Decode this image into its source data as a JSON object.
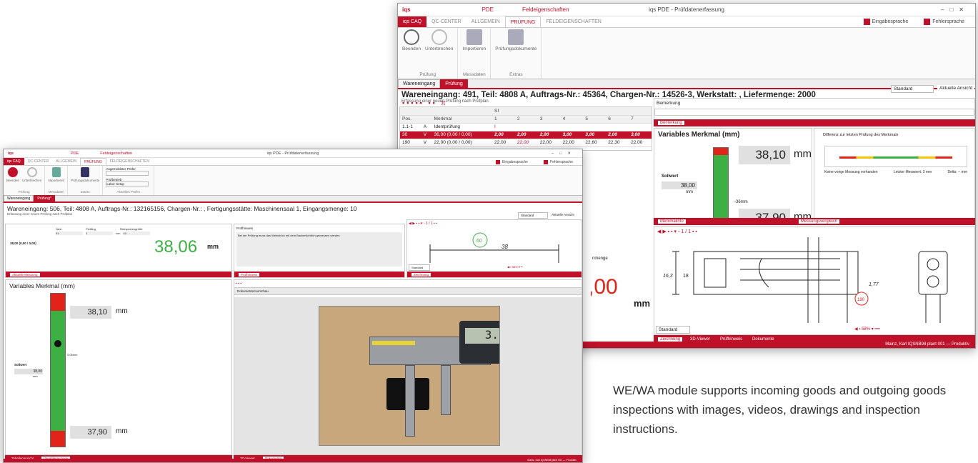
{
  "back_window": {
    "title": "iqs PDE - Prüfdatenerfassung",
    "context_tab_group": "PDE",
    "context_tab_label": "Feldeigenschaften",
    "ribbon_tabs": [
      "iqs CAQ",
      "QC-CENTER",
      "ALLGEMEIN",
      "PRÜFUNG",
      "FELDEIGENSCHAFTEN"
    ],
    "language_dialog": "Eingabesprache",
    "language_error": "Fehlersprache",
    "ribbon_groups": [
      {
        "label": "Prüfung",
        "buttons": [
          "Beenden",
          "Unterbrechen"
        ]
      },
      {
        "label": "Messdaten",
        "buttons": [
          "Importieren"
        ]
      },
      {
        "label": "Extras",
        "buttons": [
          "Prüfungsdokumente"
        ]
      }
    ],
    "doc_tabs": [
      "Wareneingang",
      "Prüfung"
    ],
    "header": "Wareneingang: 491, Teil: 4808 A, Auftrags-Nr.: 45364, Chargen-Nr.: 14526-3, Werkstatt: , Liefermenge: 2000",
    "subheader": "Erfassung einer neuen Prüfung nach Prüfplan",
    "view_select": "Standard",
    "view_label": "Aktuelle Ansicht",
    "table": {
      "group_header": "SI",
      "columns": [
        "Pos.",
        "",
        "Merkmal",
        "1",
        "2",
        "3",
        "4",
        "5",
        "6",
        "7"
      ],
      "rows": [
        {
          "pos": "1.1-1",
          "type": "A",
          "name": "Identprüfung",
          "values": [
            "I",
            "",
            "",
            "",
            "",
            "",
            ""
          ]
        },
        {
          "pos": "30",
          "type": "V",
          "name": "36,00 (0,00 / 0,00)",
          "values": [
            "2,00",
            "2,00",
            "2,00",
            "3,00",
            "3,00",
            "2,00",
            "3,00"
          ]
        },
        {
          "pos": "190",
          "type": "V",
          "name": "22,00 (0,00 / 0,00)",
          "values": [
            "22,00",
            "22,00",
            "22,00",
            "22,00",
            "22,60",
            "22,30",
            "22,00"
          ]
        }
      ]
    },
    "remark_label": "Bemerkung",
    "remark_tab": "Bemerkung",
    "variable": {
      "title": "Variables Merkmal (mm)",
      "value": "38,10",
      "unit": "mm",
      "setpoint_label": "Sollwert",
      "setpoint": "38,00",
      "setpoint_unit": "mm",
      "lower_value": "37,90",
      "offset": "-36mm"
    },
    "diff_panel": {
      "title": "Differenz zur letzten Prüfung des Merkmals",
      "left_text": "Keine vorige Messung vorhanden",
      "mid_text": "Letzter Messwert: 3 mm",
      "right_text": "Delta: -- mm"
    },
    "pane_tabs_mid": [
      "Merkmalinfo",
      "Messungsvergleich"
    ],
    "drawing_tabs": [
      "Zeichnung",
      "3D-Viewer",
      "Prüfhinweis",
      "Dokumente"
    ],
    "drawing_toolbar": {
      "page": "1 / 1",
      "zoom": "58%",
      "view": "Standard"
    },
    "drawing_dims": [
      "16,3",
      "18",
      "1,77",
      "180"
    ],
    "partial_value": ",00",
    "partial_unit": "mm",
    "partial_label": "nmenge",
    "status": "Mainz, Karl  IQSNB98  plant 001  — Produktiv"
  },
  "front_window": {
    "title": "iqs PDE - Prüfdatenerfassung",
    "context_tab_group": "PDE",
    "context_tab_label": "Feldeigenschaften",
    "ribbon_tabs": [
      "iqs CAQ",
      "QC-CENTER",
      "ALLGEMEIN",
      "PRÜFUNG",
      "FELDEIGENSCHAFTEN"
    ],
    "language_dialog": "Eingabesprache",
    "language_error": "Fehlersprache",
    "ribbon_groups": [
      {
        "label": "Prüfung",
        "buttons": [
          "Beenden",
          "Unterbrechen"
        ]
      },
      {
        "label": "Messdaten",
        "buttons": [
          "Importieren"
        ]
      },
      {
        "label": "Extras",
        "buttons": [
          "Prüfungsdokumente"
        ]
      },
      {
        "label": "Aktuelles Prüfen",
        "buttons": []
      }
    ],
    "prueffer_label": "Angemeldeter Prüfer",
    "pruefgruppe_label": "Prüfbetrieb",
    "pruefgruppe_value": "Labor Setup",
    "doc_tabs": [
      "Wareneingang",
      "Prüfung*"
    ],
    "header": "Wareneingang: 506, Teil: 4808 A, Auftrags-Nr.: 132165156, Chargen-Nr.: , Fertigungsstätte: Maschinensaal 1, Eingangsmenge: 10",
    "subheader": "Erfassung einer neuen Prüfung nach Prüfplan",
    "view_select": "Standard",
    "view_label": "Aktuelle Ansicht",
    "measure_fields": {
      "nest_label": "Nest",
      "nest_value": "01",
      "pruefling_label": "Prüfling",
      "pruefling_value": "1",
      "von_label": "von",
      "stich_label": "Stichprobengröße",
      "stich_value": "10"
    },
    "measure_spec": "38,00 (0,00 / 0,00)",
    "measure_value": "38,06",
    "measure_unit": "mm",
    "measure_tab": "Aktuelle Messung",
    "hint_title": "Prüfhinweis",
    "hint_text": "Bei der Prüfung muss das Werkstück mit dem Backenlichtlich gemessen werden.",
    "hint_tab": "Prüfhinweis",
    "drawing": {
      "bubble": "60",
      "dim": "38",
      "view": "Standard",
      "zoom": "58%",
      "page": "1 / 1"
    },
    "drawing_tab": "Zeichnung",
    "variable": {
      "title": "Variables Merkmal (mm)",
      "upper_value": "38,10",
      "lower_value": "37,90",
      "unit": "mm",
      "setpoint_label": "Sollwert",
      "setpoint": "38,00",
      "setpoint_unit": "mm",
      "delta": "0,06mm"
    },
    "var_tabs": [
      "Tabellenansicht",
      "Variablenanzeige"
    ],
    "doc_panel_label": "Dokumentenvorschau",
    "caliper_reading": "3.",
    "doc_tabs_bottom": [
      "3D-Viewer",
      "Dokumente"
    ],
    "status": "Mainz, Karl  IQSNB98  plant 001  — Produktiv"
  },
  "caption": "WE/WA module supports incoming goods and outgoing goods inspections with images, videos, drawings and inspection instructions.",
  "colors": {
    "brand_red": "#c0112b",
    "gauge_green": "#3cb043",
    "gauge_red": "#e2231a",
    "value_green": "#3cb043"
  }
}
